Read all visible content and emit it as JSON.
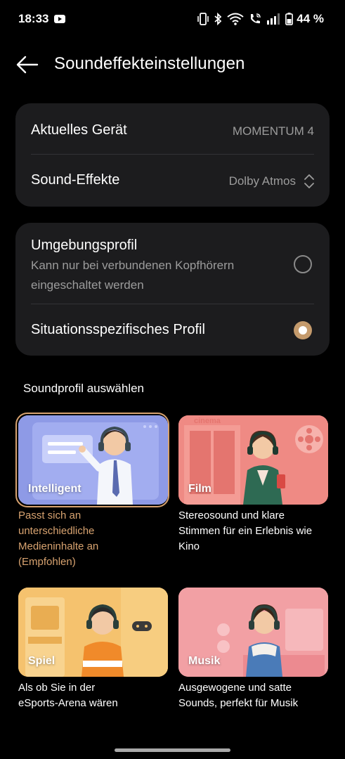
{
  "status_bar": {
    "time": "18:33",
    "battery": "44 %",
    "icons": [
      "youtube-icon",
      "vibrate-icon",
      "bluetooth-icon",
      "wifi-icon",
      "wifi-call-icon",
      "signal-icon",
      "battery-icon"
    ]
  },
  "header": {
    "title": "Soundeffekteinstellungen"
  },
  "device_card": {
    "current_device_label": "Aktuelles Gerät",
    "current_device_value": "MOMENTUM 4",
    "sound_effects_label": "Sound-Effekte",
    "sound_effects_value": "Dolby Atmos"
  },
  "profile_mode_card": {
    "ambient_profile": {
      "title": "Umgebungsprofil",
      "subtitle_line1": "Kann nur bei verbundenen Kopfhörern",
      "subtitle_line2": "eingeschaltet werden",
      "selected": false
    },
    "situational_profile": {
      "title": "Situationsspezifisches Profil",
      "selected": true
    }
  },
  "sound_profiles": {
    "section_title": "Soundprofil auswählen",
    "items": [
      {
        "label": "Intelligent",
        "desc": [
          "Passt sich an",
          "unterschiedliche",
          "Medieninhalte an",
          "(Empfohlen)"
        ],
        "selected": true,
        "color": "#8e9ae6"
      },
      {
        "label": "Film",
        "desc": [
          "Stereosound und klare",
          "Stimmen für ein Erlebnis wie",
          "Kino"
        ],
        "selected": false,
        "color": "#ef8a84"
      },
      {
        "label": "Spiel",
        "desc": [
          "Als ob Sie in der",
          "eSports-Arena wären"
        ],
        "selected": false,
        "color": "#f5c26e"
      },
      {
        "label": "Musik",
        "desc": [
          "Ausgewogene und satte",
          "Sounds, perfekt für Musik"
        ],
        "selected": false,
        "color": "#f2a0a4"
      }
    ],
    "film_sign_text": "cinema"
  },
  "colors": {
    "background": "#000000",
    "card": "#1c1c1e",
    "accent": "#d8a370",
    "radio_on": "#c49a6c",
    "secondary_text": "#9c9c9c"
  }
}
